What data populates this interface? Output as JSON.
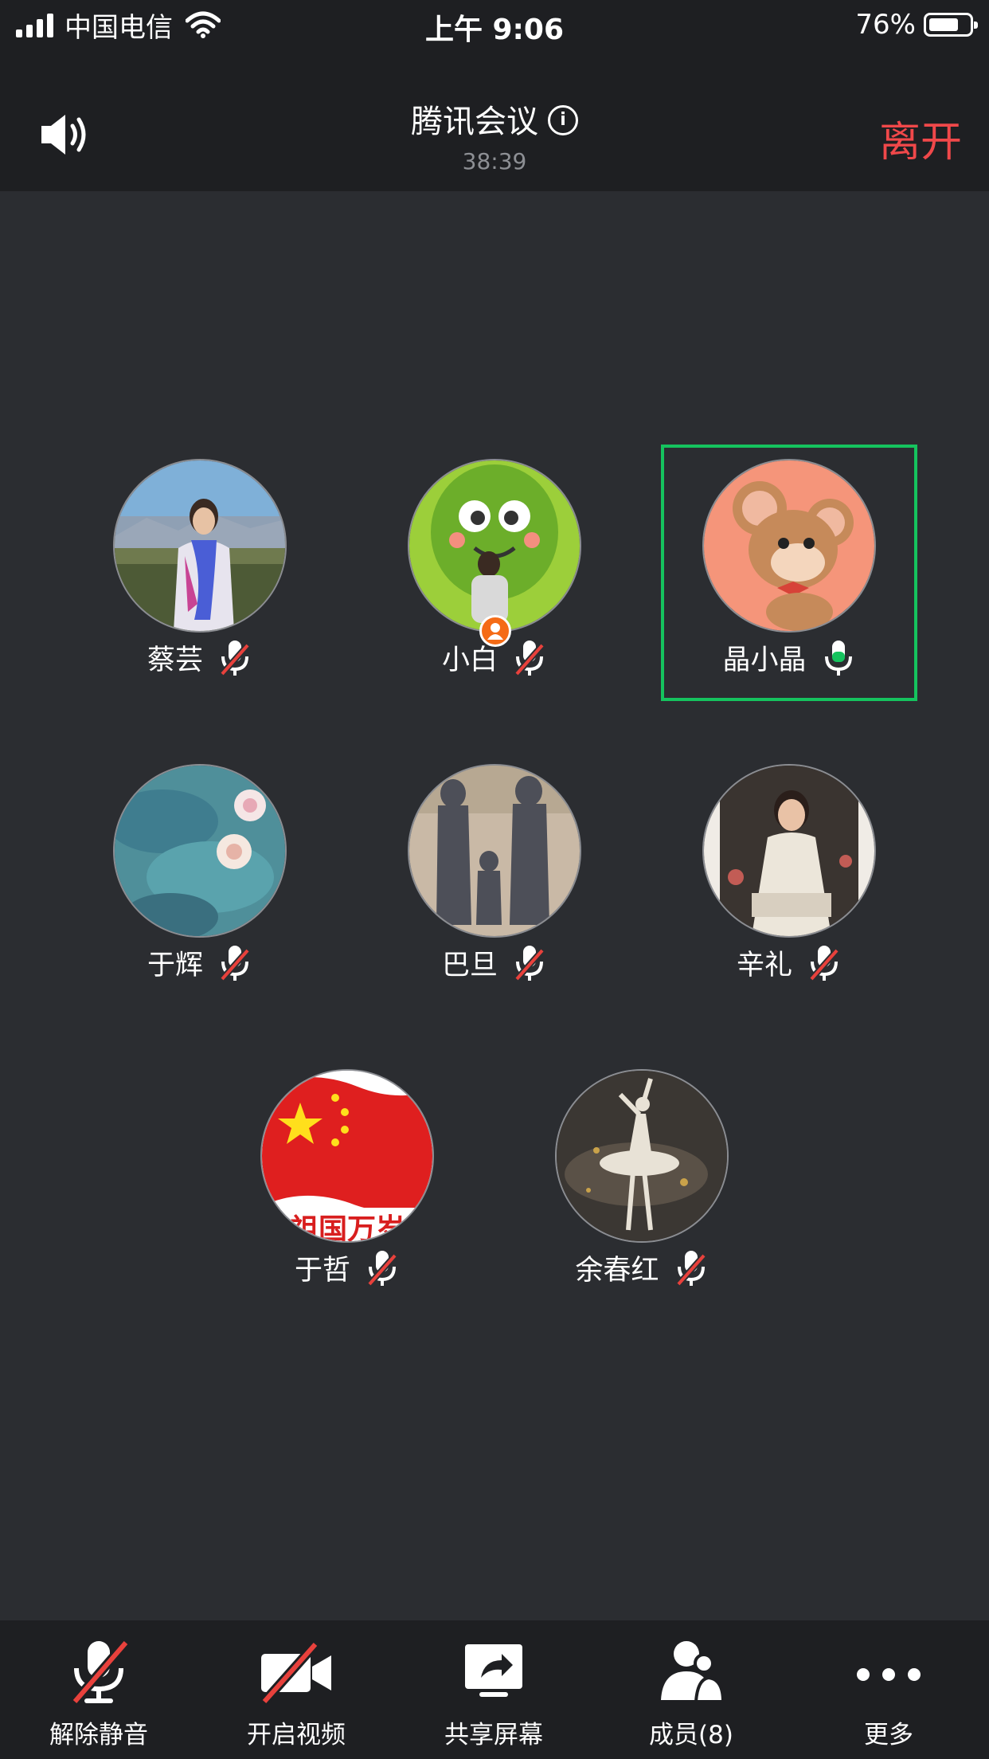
{
  "status_bar": {
    "carrier": "中国电信",
    "time": "上午 9:06",
    "battery_percent": "76%",
    "battery_level": 0.76,
    "signal_bars": 4
  },
  "header": {
    "title": "腾讯会议",
    "info_icon": "i",
    "duration": "38:39",
    "leave_label": "离开",
    "speaker_icon": "speaker-icon"
  },
  "participants": [
    {
      "name": "蔡芸",
      "mic": "muted",
      "avatar_icon": "landscape-portrait-avatar"
    },
    {
      "name": "小白",
      "mic": "muted",
      "avatar_icon": "cartoon-green-monster-avatar",
      "host": true
    },
    {
      "name": "晶小晶",
      "mic": "active",
      "avatar_icon": "cartoon-mouse-avatar",
      "speaking": true
    },
    {
      "name": "于辉",
      "mic": "muted",
      "avatar_icon": "water-lily-painting-avatar"
    },
    {
      "name": "巴旦",
      "mic": "muted",
      "avatar_icon": "family-shadow-avatar"
    },
    {
      "name": "辛礼",
      "mic": "muted",
      "avatar_icon": "woman-qipao-avatar"
    },
    {
      "name": "于哲",
      "mic": "muted",
      "avatar_icon": "red-flag-avatar",
      "avatar_text": "祖国万岁"
    },
    {
      "name": "余春红",
      "mic": "muted",
      "avatar_icon": "ballerina-avatar"
    }
  ],
  "toolbar": {
    "unmute": "解除静音",
    "video": "开启视频",
    "share": "共享屏幕",
    "members": "成员(8)",
    "more": "更多"
  },
  "colors": {
    "background": "#2b2d31",
    "bar": "#1e1f22",
    "leave": "#f0484a",
    "speaking_frame": "#15c35e",
    "mute_slash": "#e8413c",
    "host_badge": "#f56b16"
  }
}
